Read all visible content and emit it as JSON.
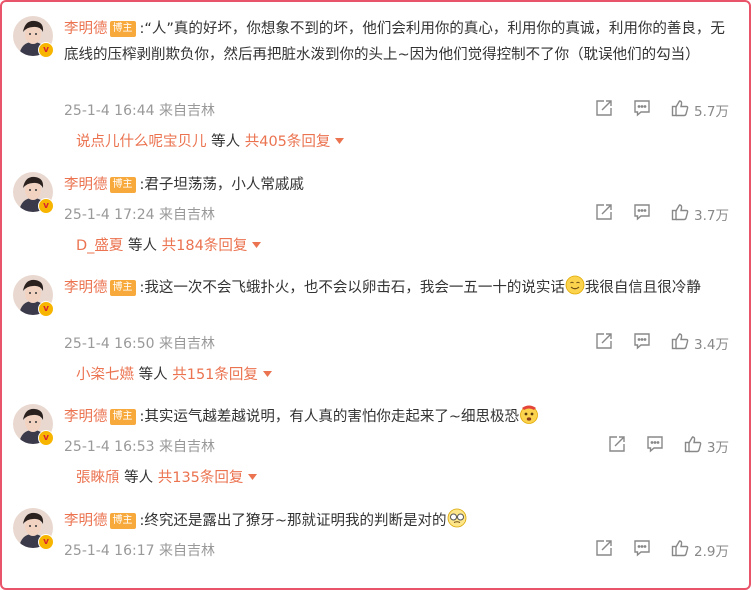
{
  "comments": [
    {
      "user": "李明德",
      "badge": "博主",
      "content": ":“人”真的好坏，你想象不到的坏，他们会利用你的真心，利用你的真诚，利用你的善良，无底线的压榨剥削欺负你，然后再把脏水泼到你的头上~因为他们觉得控制不了你（耽误他们的勾当）",
      "emoji": "",
      "content_after": "",
      "time": "25-1-4 16:44",
      "location": "来自吉林",
      "likes": "5.7万",
      "reply_user": "说点儿什么呢宝贝儿",
      "reply_etc": "等人",
      "reply_total": "共405条回复"
    },
    {
      "user": "李明德",
      "badge": "博主",
      "content": ":君子坦荡荡，小人常戚戚",
      "emoji": "",
      "content_after": "",
      "time": "25-1-4 17:24",
      "location": "来自吉林",
      "likes": "3.7万",
      "reply_user": "D_盛夏",
      "reply_etc": "等人",
      "reply_total": "共184条回复"
    },
    {
      "user": "李明德",
      "badge": "博主",
      "content": ":我这一次不会飞蛾扑火，也不会以卵击石，我会一五一十的说实话",
      "emoji": "smile-emoji",
      "content_after": "我很自信且很冷静",
      "time": "25-1-4 16:50",
      "location": "来自吉林",
      "likes": "3.4万",
      "reply_user": "小栥七嬿",
      "reply_etc": "等人",
      "reply_total": "共151条回复"
    },
    {
      "user": "李明德",
      "badge": "博主",
      "content": ":其实运气越差越说明，有人真的害怕你走起来了~细思极恐",
      "emoji": "fear-emoji",
      "content_after": "",
      "time": "25-1-4 16:53",
      "location": "来自吉林",
      "likes": "3万",
      "reply_user": "張睞頎",
      "reply_etc": "等人",
      "reply_total": "共135条回复"
    },
    {
      "user": "李明德",
      "badge": "博主",
      "content": ":终究还是露出了獠牙~那就证明我的判断是对的",
      "emoji": "glasses-emoji",
      "content_after": "",
      "time": "25-1-4 16:17",
      "location": "来自吉林",
      "likes": "2.9万",
      "reply_user": "",
      "reply_etc": "",
      "reply_total": ""
    }
  ],
  "icons": {
    "share": "share-icon",
    "comment": "comment-icon",
    "like": "like-icon",
    "caret": "caret-down-icon"
  },
  "colors": {
    "frame": "#e9546b",
    "username": "#eb7350",
    "badge": "#f7a93c",
    "meta": "#999999"
  }
}
